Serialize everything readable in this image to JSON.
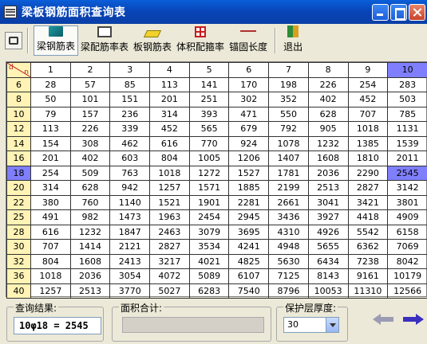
{
  "window": {
    "title": "梁板钢筋面积查询表"
  },
  "toolbar": {
    "items": [
      {
        "label": "梁钢筋表",
        "icon": "beam-rebar-icon",
        "active": true
      },
      {
        "label": "梁配筋率表",
        "icon": "beam-ratio-icon",
        "active": false
      },
      {
        "label": "板钢筋表",
        "icon": "slab-rebar-icon",
        "active": false
      },
      {
        "label": "体积配箍率",
        "icon": "volume-stirrup-icon",
        "active": false
      },
      {
        "label": "锚固长度",
        "icon": "anchor-length-icon",
        "active": false
      },
      {
        "label": "退出",
        "icon": "exit-icon",
        "active": false
      }
    ]
  },
  "table": {
    "corner_top": "n",
    "corner_bottom": "d",
    "columns": [
      "1",
      "2",
      "3",
      "4",
      "5",
      "6",
      "7",
      "8",
      "9",
      "10"
    ],
    "selected_column": "10",
    "selected_row": "18",
    "rows": [
      {
        "d": "6",
        "values": [
          "28",
          "57",
          "85",
          "113",
          "141",
          "170",
          "198",
          "226",
          "254",
          "283"
        ]
      },
      {
        "d": "8",
        "values": [
          "50",
          "101",
          "151",
          "201",
          "251",
          "302",
          "352",
          "402",
          "452",
          "503"
        ]
      },
      {
        "d": "10",
        "values": [
          "79",
          "157",
          "236",
          "314",
          "393",
          "471",
          "550",
          "628",
          "707",
          "785"
        ]
      },
      {
        "d": "12",
        "values": [
          "113",
          "226",
          "339",
          "452",
          "565",
          "679",
          "792",
          "905",
          "1018",
          "1131"
        ]
      },
      {
        "d": "14",
        "values": [
          "154",
          "308",
          "462",
          "616",
          "770",
          "924",
          "1078",
          "1232",
          "1385",
          "1539"
        ]
      },
      {
        "d": "16",
        "values": [
          "201",
          "402",
          "603",
          "804",
          "1005",
          "1206",
          "1407",
          "1608",
          "1810",
          "2011"
        ]
      },
      {
        "d": "18",
        "values": [
          "254",
          "509",
          "763",
          "1018",
          "1272",
          "1527",
          "1781",
          "2036",
          "2290",
          "2545"
        ]
      },
      {
        "d": "20",
        "values": [
          "314",
          "628",
          "942",
          "1257",
          "1571",
          "1885",
          "2199",
          "2513",
          "2827",
          "3142"
        ]
      },
      {
        "d": "22",
        "values": [
          "380",
          "760",
          "1140",
          "1521",
          "1901",
          "2281",
          "2661",
          "3041",
          "3421",
          "3801"
        ]
      },
      {
        "d": "25",
        "values": [
          "491",
          "982",
          "1473",
          "1963",
          "2454",
          "2945",
          "3436",
          "3927",
          "4418",
          "4909"
        ]
      },
      {
        "d": "28",
        "values": [
          "616",
          "1232",
          "1847",
          "2463",
          "3079",
          "3695",
          "4310",
          "4926",
          "5542",
          "6158"
        ]
      },
      {
        "d": "30",
        "values": [
          "707",
          "1414",
          "2121",
          "2827",
          "3534",
          "4241",
          "4948",
          "5655",
          "6362",
          "7069"
        ]
      },
      {
        "d": "32",
        "values": [
          "804",
          "1608",
          "2413",
          "3217",
          "4021",
          "4825",
          "5630",
          "6434",
          "7238",
          "8042"
        ]
      },
      {
        "d": "36",
        "values": [
          "1018",
          "2036",
          "3054",
          "4072",
          "5089",
          "6107",
          "7125",
          "8143",
          "9161",
          "10179"
        ]
      },
      {
        "d": "40",
        "values": [
          "1257",
          "2513",
          "3770",
          "5027",
          "6283",
          "7540",
          "8796",
          "10053",
          "11310",
          "12566"
        ]
      }
    ]
  },
  "query": {
    "label": "查询结果:",
    "value": "10φ18 = 2545"
  },
  "area_total": {
    "label": "面积合计:",
    "value": ""
  },
  "cover": {
    "label": "保护层厚度:",
    "selected": "30"
  },
  "nav": {
    "prev_icon": "arrow-left-icon",
    "next_icon": "arrow-right-icon"
  },
  "colors": {
    "selected": "#7f7ffd",
    "header_bg": "#fff3b5",
    "title_bar": "#0a5fd8"
  }
}
